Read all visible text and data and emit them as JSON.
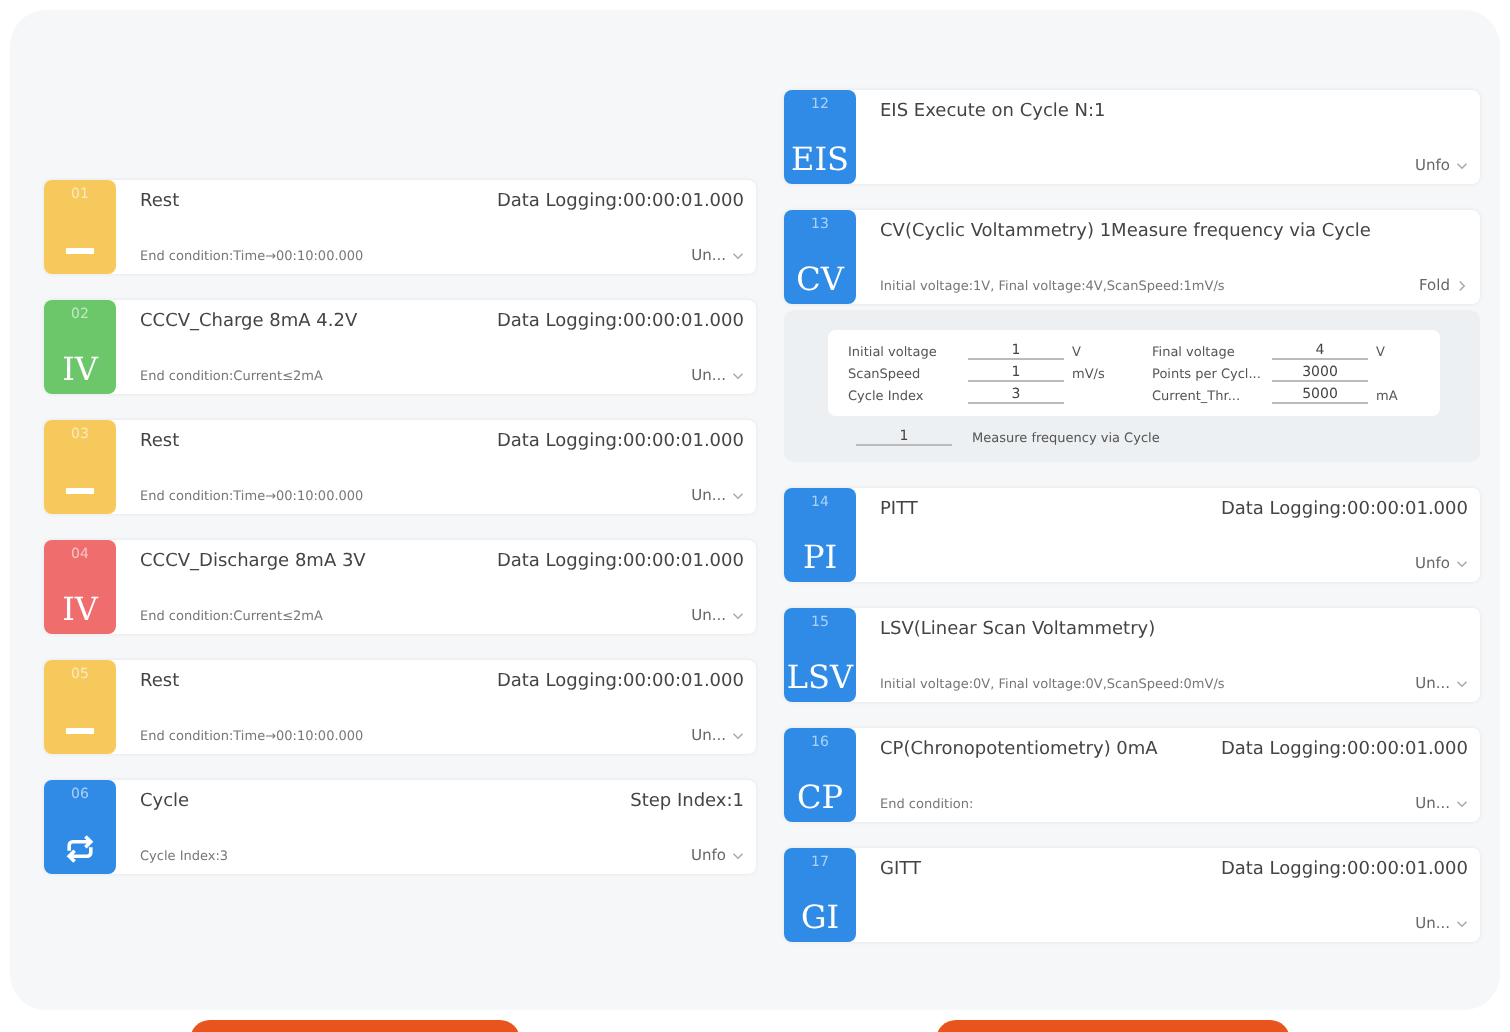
{
  "left_steps": [
    {
      "number": "01",
      "kind": "dash",
      "color": "#f7c95c",
      "title": "Rest",
      "info": "Data Logging:00:00:01.000",
      "detail": "End condition:Time→00:10:00.000",
      "toggle": "Un...",
      "expanded": false
    },
    {
      "number": "02",
      "kind": "text",
      "badge": "IV",
      "color": "#6cc76a",
      "title": "CCCV_Charge 8mA 4.2V",
      "info": "Data Logging:00:00:01.000",
      "detail": "End condition:Current≤2mA",
      "toggle": "Un...",
      "expanded": false
    },
    {
      "number": "03",
      "kind": "dash",
      "color": "#f7c95c",
      "title": "Rest",
      "info": "Data Logging:00:00:01.000",
      "detail": "End condition:Time→00:10:00.000",
      "toggle": "Un...",
      "expanded": false
    },
    {
      "number": "04",
      "kind": "text",
      "badge": "IV",
      "color": "#f06d6d",
      "title": "CCCV_Discharge 8mA 3V",
      "info": "Data Logging:00:00:01.000",
      "detail": "End condition:Current≤2mA",
      "toggle": "Un...",
      "expanded": false
    },
    {
      "number": "05",
      "kind": "dash",
      "color": "#f7c95c",
      "title": "Rest",
      "info": "Data Logging:00:00:01.000",
      "detail": "End condition:Time→00:10:00.000",
      "toggle": "Un...",
      "expanded": false
    },
    {
      "number": "06",
      "kind": "cycle",
      "color": "#2f8be6",
      "title": "Cycle",
      "info": "Step Index:1",
      "detail": "Cycle Index:3",
      "toggle": "Unfo",
      "expanded": false
    }
  ],
  "right_steps": [
    {
      "number": "12",
      "kind": "text",
      "badge": "EIS",
      "color": "#2f8be6",
      "title": "EIS Execute on Cycle N:1",
      "toggle": "Unfo",
      "expanded": false
    },
    {
      "number": "13",
      "kind": "text",
      "badge": "CV",
      "color": "#2f8be6",
      "title": "CV(Cyclic Voltammetry) 1Measure frequency via Cycle",
      "detail": "Initial voltage:1V, Final voltage:4V,ScanSpeed:1mV/s",
      "toggle": "Fold",
      "expanded": true,
      "params": [
        {
          "label": "Initial voltage",
          "value": "1",
          "unit": "V"
        },
        {
          "label": "Final voltage",
          "value": "4",
          "unit": "V"
        },
        {
          "label": "ScanSpeed",
          "value": "1",
          "unit": "mV/s"
        },
        {
          "label": "Points per Cycl...",
          "value": "3000"
        },
        {
          "label": "Cycle Index",
          "value": "3"
        },
        {
          "label": "Current_Thr...",
          "value": "5000",
          "unit": "mA"
        }
      ],
      "frequency": {
        "value": "1",
        "label": "Measure frequency via Cycle"
      }
    },
    {
      "number": "14",
      "kind": "text",
      "badge": "PI",
      "color": "#2f8be6",
      "title": "PITT",
      "info": "Data Logging:00:00:01.000",
      "toggle": "Unfo",
      "expanded": false
    },
    {
      "number": "15",
      "kind": "text",
      "badge": "LSV",
      "color": "#2f8be6",
      "title": "LSV(Linear Scan Voltammetry)",
      "detail": "Initial voltage:0V, Final voltage:0V,ScanSpeed:0mV/s",
      "toggle": "Un...",
      "expanded": false
    },
    {
      "number": "16",
      "kind": "text",
      "badge": "CP",
      "color": "#2f8be6",
      "title": "CP(Chronopotentiometry) 0mA",
      "info": "Data Logging:00:00:01.000",
      "detail": "End condition:",
      "toggle": "Un...",
      "expanded": false
    },
    {
      "number": "17",
      "kind": "text",
      "badge": "GI",
      "color": "#2f8be6",
      "title": "GITT",
      "info": "Data Logging:00:00:01.000",
      "toggle": "Un...",
      "expanded": false
    }
  ],
  "buttons": [
    {
      "kind": "action"
    },
    {
      "kind": "action"
    }
  ]
}
